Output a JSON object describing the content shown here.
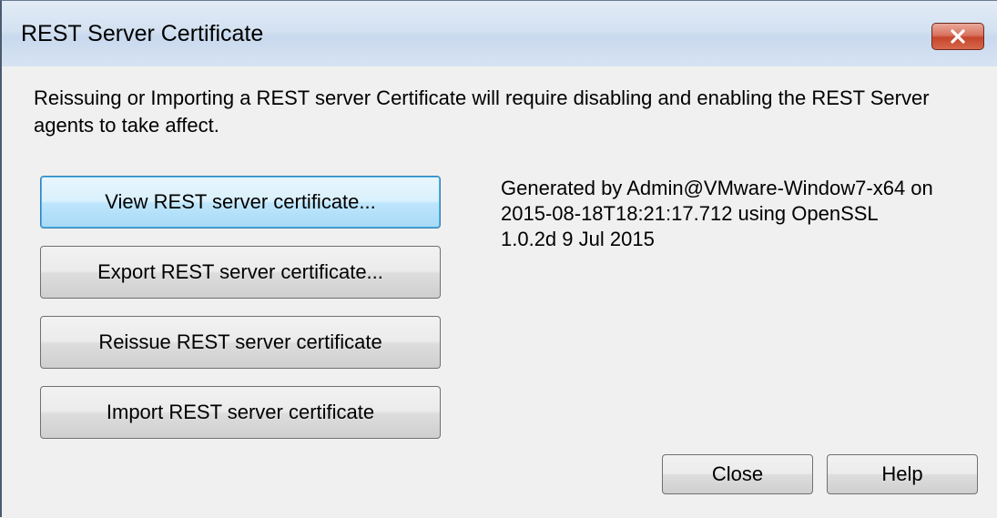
{
  "window": {
    "title": "REST Server Certificate"
  },
  "intro_text": "Reissuing or Importing a REST server Certificate will require disabling and enabling the REST Server agents to take affect.",
  "buttons": {
    "view": "View REST server certificate...",
    "export": "Export REST server certificate...",
    "reissue": "Reissue REST server certificate",
    "import": "Import REST server certificate",
    "close": "Close",
    "help": "Help"
  },
  "generated_info": {
    "line1": "Generated by Admin@VMware-Window7-x64 on",
    "line2": "2015-08-18T18:21:17.712 using OpenSSL",
    "line3": "1.0.2d 9 Jul 2015"
  },
  "icons": {
    "close": "close-icon"
  },
  "colors": {
    "close_button": "#c6462c",
    "default_button_border": "#3c7fb1",
    "titlebar": "#d3e1f1"
  }
}
